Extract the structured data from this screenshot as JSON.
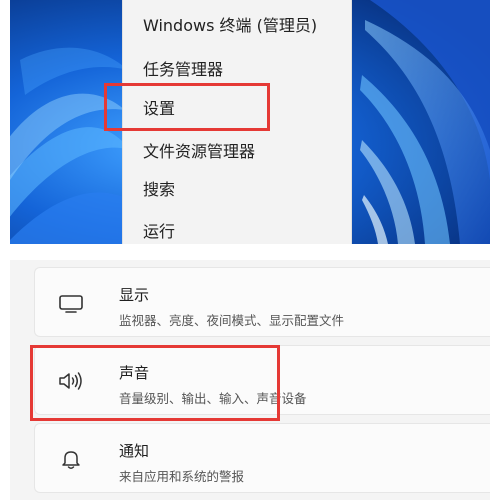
{
  "context_menu": {
    "items": [
      {
        "label": "Windows 终端 (管理员)"
      },
      {
        "label": "任务管理器"
      },
      {
        "label": "设置"
      },
      {
        "label": "文件资源管理器"
      },
      {
        "label": "搜索"
      },
      {
        "label": "运行"
      }
    ],
    "highlighted_item": "设置",
    "highlight_color": "#e53935"
  },
  "settings": {
    "items": [
      {
        "title": "显示",
        "subtitle": "监视器、亮度、夜间模式、显示配置文件",
        "icon": "monitor-icon"
      },
      {
        "title": "声音",
        "subtitle": "音量级别、输出、输入、声音设备",
        "icon": "speaker-icon"
      },
      {
        "title": "通知",
        "subtitle": "来自应用和系统的警报",
        "icon": "bell-icon"
      }
    ],
    "highlighted_item": "声音",
    "highlight_color": "#e53935"
  },
  "colors": {
    "wallpaper_base": "#0b3f9e",
    "menu_background": "#f3f3f3",
    "settings_background": "#f4f4f4",
    "card_background": "#fbfbfb"
  }
}
